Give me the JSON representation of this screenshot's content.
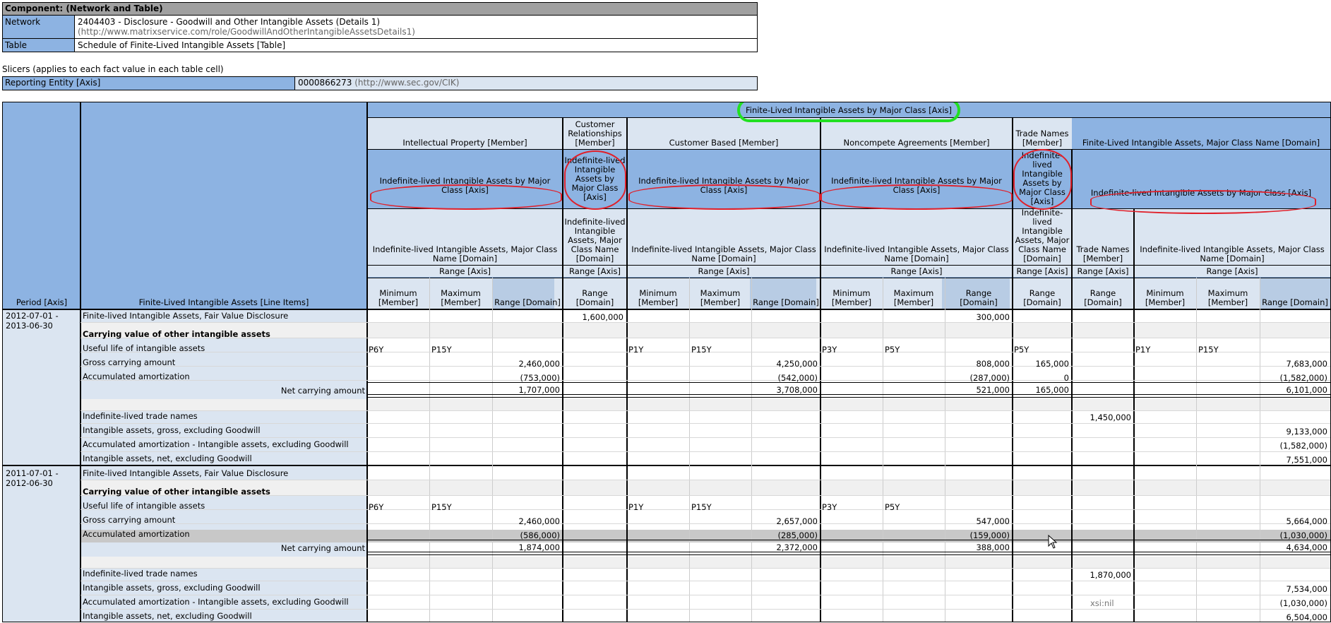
{
  "component": {
    "title": "Component: (Network and Table)",
    "network_label": "Network",
    "network_value": "2404403 - Disclosure - Goodwill and Other Intangible Assets (Details 1)",
    "network_url": "(http://www.matrixservice.com/role/GoodwillAndOtherIntangibleAssetsDetails1)",
    "table_label": "Table",
    "table_value": "Schedule of Finite-Lived Intangible Assets [Table]"
  },
  "slicers": {
    "title": "Slicers (applies to each fact value in each table cell)",
    "entity_label": "Reporting Entity [Axis]",
    "entity_value": "0000866273",
    "entity_url": "(http://www.sec.gov/CIK)"
  },
  "headers": {
    "period_axis": "Period [Axis]",
    "line_items": "Finite-Lived Intangible Assets [Line Items]",
    "top_axis": "Finite-Lived Intangible Assets by Major Class [Axis]",
    "members": [
      "Intellectual Property [Member]",
      "Customer Relationships [Member]",
      "Customer Based [Member]",
      "Noncompete Agreements [Member]",
      "Trade Names [Member]",
      "Finite-Lived Intangible Assets, Major Class Name [Domain]"
    ],
    "indef_axis": "Indefinite-lived Intangible Assets by Major Class [Axis]",
    "indef_domain": "Indefinite-lived Intangible Assets, Major Class Name [Domain]",
    "trade_names_member": "Trade Names [Member]",
    "range_axis": "Range [Axis]",
    "minimum": "Minimum [Member]",
    "maximum": "Maximum [Member]",
    "range_domain": "Range [Domain]"
  },
  "periods": [
    "2012-07-01 - 2013-06-30",
    "2011-07-01 - 2012-06-30"
  ],
  "row_labels": [
    "Finite-lived Intangible Assets, Fair Value Disclosure",
    "Carrying value of other intangible assets",
    "Useful life of intangible assets",
    "Gross carrying amount",
    "Accumulated amortization",
    "Net carrying amount",
    "Indefinite-lived trade names",
    "Intangible assets, gross, excluding Goodwill",
    "Accumulated amortization - Intangible assets, excluding Goodwill",
    "Intangible assets, net, excluding Goodwill"
  ],
  "p1": {
    "fair_value": {
      "cr": "1,600,000",
      "nc": "300,000"
    },
    "useful": {
      "ip_min": "P6Y",
      "ip_max": "P15Y",
      "cb_min": "P1Y",
      "cb_max": "P15Y",
      "nc_min": "P3Y",
      "nc_max": "P5Y",
      "tn": "P5Y",
      "fl_min": "P1Y",
      "fl_max": "P15Y"
    },
    "gross": {
      "ip": "2,460,000",
      "cb": "4,250,000",
      "nc": "808,000",
      "tn": "165,000",
      "fl": "7,683,000"
    },
    "accum": {
      "ip": "(753,000)",
      "cb": "(542,000)",
      "nc": "(287,000)",
      "tn": "0",
      "fl": "(1,582,000)"
    },
    "net": {
      "ip": "1,707,000",
      "cb": "3,708,000",
      "nc": "521,000",
      "tn": "165,000",
      "fl": "6,101,000"
    },
    "trade_names": "1,450,000",
    "ia_gross": "9,133,000",
    "ia_accum": "(1,582,000)",
    "ia_net": "7,551,000"
  },
  "p2": {
    "useful": {
      "ip_min": "P6Y",
      "ip_max": "P15Y",
      "cb_min": "P1Y",
      "cb_max": "P15Y",
      "nc_min": "P3Y",
      "nc_max": "P5Y"
    },
    "gross": {
      "ip": "2,460,000",
      "cb": "2,657,000",
      "nc": "547,000",
      "fl": "5,664,000"
    },
    "accum": {
      "ip": "(586,000)",
      "cb": "(285,000)",
      "nc": "(159,000)",
      "fl": "(1,030,000)"
    },
    "net": {
      "ip": "1,874,000",
      "cb": "2,372,000",
      "nc": "388,000",
      "fl": "4,634,000"
    },
    "trade_names": "1,870,000",
    "ia_gross": "7,534,000",
    "ia_accum": "(1,030,000)",
    "xsi_nil": "xsi:nil",
    "ia_net": "6,504,000"
  },
  "colors": {
    "header_blue": "#8db3e2",
    "light_blue": "#dbe5f1",
    "gray_row": "#f0f0f0",
    "highlight_row": "#c8c8c8",
    "ring_red": "#e0202a",
    "ring_green": "#22e022"
  }
}
